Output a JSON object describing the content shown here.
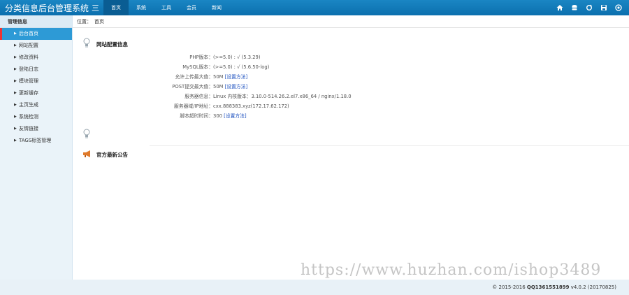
{
  "app": {
    "title": "分类信息后台管理系统",
    "menu_glyph": "三"
  },
  "nav": [
    {
      "label": "首页",
      "active": true
    },
    {
      "label": "系统"
    },
    {
      "label": "工具"
    },
    {
      "label": "会员"
    },
    {
      "label": "新闻"
    }
  ],
  "top_icons": [
    "home-icon",
    "database-icon",
    "refresh-icon",
    "save-icon",
    "power-icon"
  ],
  "sidebar": {
    "header": "管理信息",
    "items": [
      {
        "label": "后台首页",
        "active": true
      },
      {
        "label": "网站配置"
      },
      {
        "label": "修改资料"
      },
      {
        "label": "登陆日志"
      },
      {
        "label": "模块管理"
      },
      {
        "label": "更新缓存"
      },
      {
        "label": "主页生成"
      },
      {
        "label": "系统检测"
      },
      {
        "label": "友情链接"
      },
      {
        "label": "TAGS标签管理"
      }
    ]
  },
  "breadcrumb": {
    "label": "位置：",
    "current": "首页"
  },
  "config": {
    "title": "网站配置信息",
    "rows": [
      {
        "label": "PHP版本：",
        "value": "(>=5.0) : √  (5.3.29)",
        "link": ""
      },
      {
        "label": "MySQL版本：",
        "value": "(>=5.0) : √  (5.6.50-log)",
        "link": ""
      },
      {
        "label": "允许上传最大值：",
        "value": "50M ",
        "link": "[设置方法]"
      },
      {
        "label": "POST提交最大值：",
        "value": "50M ",
        "link": "[设置方法]"
      },
      {
        "label": "服务器信息：",
        "value": "Linux  内核版本：3.10.0-514.26.2.el7.x86_64 / nginx/1.18.0",
        "link": ""
      },
      {
        "label": "服务器域/IP地址：",
        "value": "cxx.888383.xyz(172.17.62.172)",
        "link": ""
      },
      {
        "label": "脚本超时时间：",
        "value": "300 ",
        "link": "[设置方法]"
      }
    ]
  },
  "announcement": {
    "title": "官方最新公告"
  },
  "footer": {
    "prefix": "© 2015-2016 ",
    "qq": "QQ1361551899",
    "version": " v4.0.2 (20170825)"
  },
  "watermark": "https://www.huzhan.com/ishop3489",
  "colors": {
    "topbar": "#0b6fae",
    "sidebar_active": "#2d9ad6",
    "link": "#1b4fbf"
  }
}
